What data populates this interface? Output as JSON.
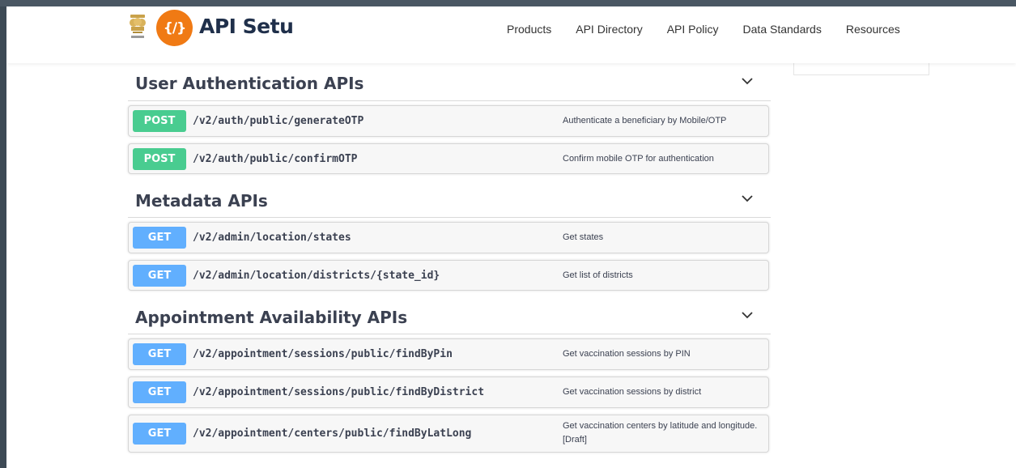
{
  "brand": {
    "name": "API Setu",
    "logo_text": "{/}"
  },
  "nav": [
    "Products",
    "API Directory",
    "API Policy",
    "Data Standards",
    "Resources"
  ],
  "sections": [
    {
      "title": "User Authentication APIs",
      "ops": [
        {
          "method": "POST",
          "path": "/v2/auth/public/generateOTP",
          "desc": "Authenticate a beneficiary by Mobile/OTP"
        },
        {
          "method": "POST",
          "path": "/v2/auth/public/confirmOTP",
          "desc": "Confirm mobile OTP for authentication"
        }
      ]
    },
    {
      "title": "Metadata APIs",
      "ops": [
        {
          "method": "GET",
          "path": "/v2/admin/location/states",
          "desc": "Get states"
        },
        {
          "method": "GET",
          "path": "/v2/admin/location/districts/{state_id}",
          "desc": "Get list of districts"
        }
      ]
    },
    {
      "title": "Appointment Availability APIs",
      "ops": [
        {
          "method": "GET",
          "path": "/v2/appointment/sessions/public/findByPin",
          "desc": "Get vaccination sessions by PIN"
        },
        {
          "method": "GET",
          "path": "/v2/appointment/sessions/public/findByDistrict",
          "desc": "Get vaccination sessions by district"
        },
        {
          "method": "GET",
          "path": "/v2/appointment/centers/public/findByLatLong",
          "desc": "Get vaccination centers by latitude and longitude. [Draft]"
        }
      ]
    }
  ],
  "colors": {
    "post": "#49cc90",
    "get": "#61affe",
    "brand_orange": "#f07a14",
    "brand_navy": "#1f2f4a"
  },
  "icons": {
    "emblem": "state-emblem-icon",
    "chevron": "chevron-down-icon"
  }
}
